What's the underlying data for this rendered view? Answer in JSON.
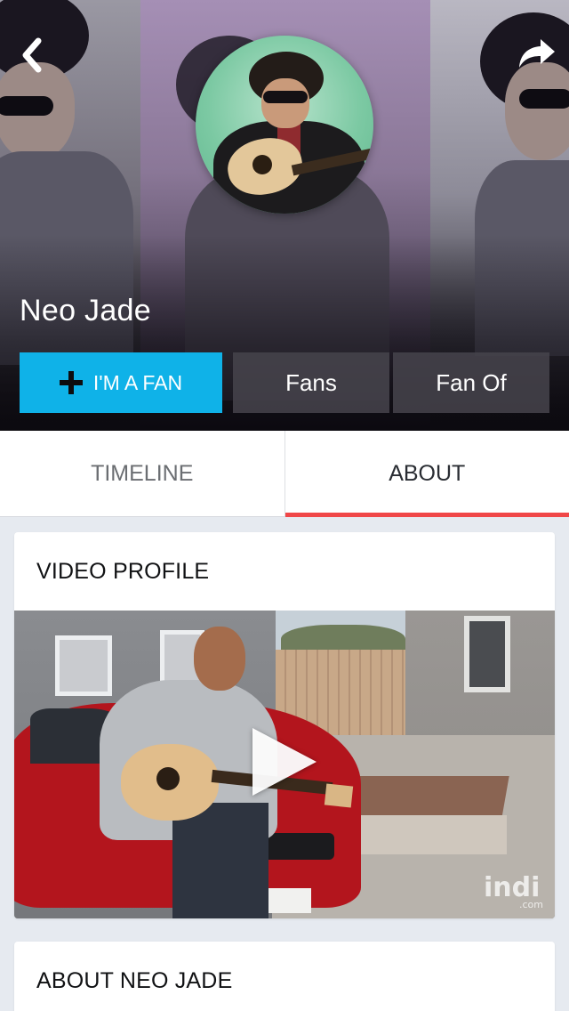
{
  "header": {
    "artist_name": "Neo Jade",
    "back_icon": "chevron-left-icon",
    "share_icon": "share-arrow-icon"
  },
  "actions": {
    "fan_label": "I'M A FAN",
    "fans_label": "Fans",
    "fan_of_label": "Fan Of",
    "fan_icon": "plus-icon"
  },
  "tabs": [
    {
      "label": "TIMELINE",
      "active": false
    },
    {
      "label": "ABOUT",
      "active": true
    }
  ],
  "sections": {
    "video_profile_title": "VIDEO PROFILE",
    "about_title": "ABOUT NEO JADE",
    "watermark": "indi",
    "watermark_sub": ".com"
  },
  "colors": {
    "fan_button": "#0fb2e8",
    "active_tab_underline": "#f04748",
    "page_background": "#e6eaf0"
  }
}
